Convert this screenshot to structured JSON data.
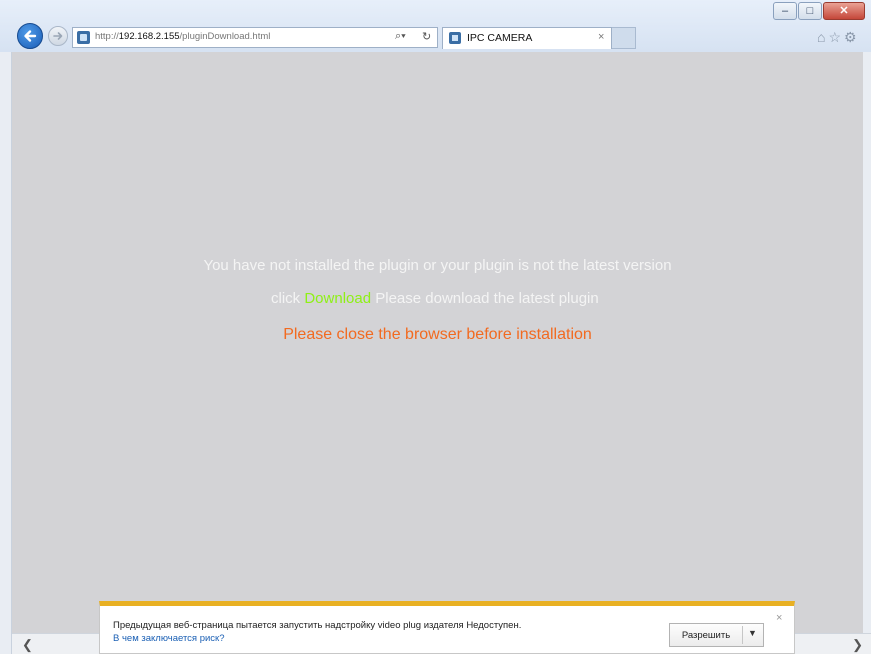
{
  "browser": {
    "url_prefix": "http://",
    "url_host": "192.168.2.155",
    "url_path": "/pluginDownload.html",
    "tab_title": "IPC CAMERA",
    "icons": [
      "back-icon",
      "forward-icon",
      "search-icon",
      "refresh-icon",
      "home-icon",
      "favorites-star-icon",
      "gear-icon"
    ]
  },
  "page": {
    "line1": "You have not installed the plugin or your plugin is not the latest version",
    "line2_prefix": "click",
    "download_link": "Download",
    "line2_suffix": "Please download the latest plugin",
    "line3": "Please close the browser before installation"
  },
  "notification": {
    "message": "Предыдущая веб-страница пытается запустить надстройку video plug издателя Недоступен.",
    "risk_link": "В чем заключается риск?",
    "allow_label": "Разрешить"
  },
  "colors": {
    "content_bg": "#d3d3d6",
    "download_link": "#8ef016",
    "warning_text": "#f26a20",
    "notification_accent": "#e8b023"
  }
}
